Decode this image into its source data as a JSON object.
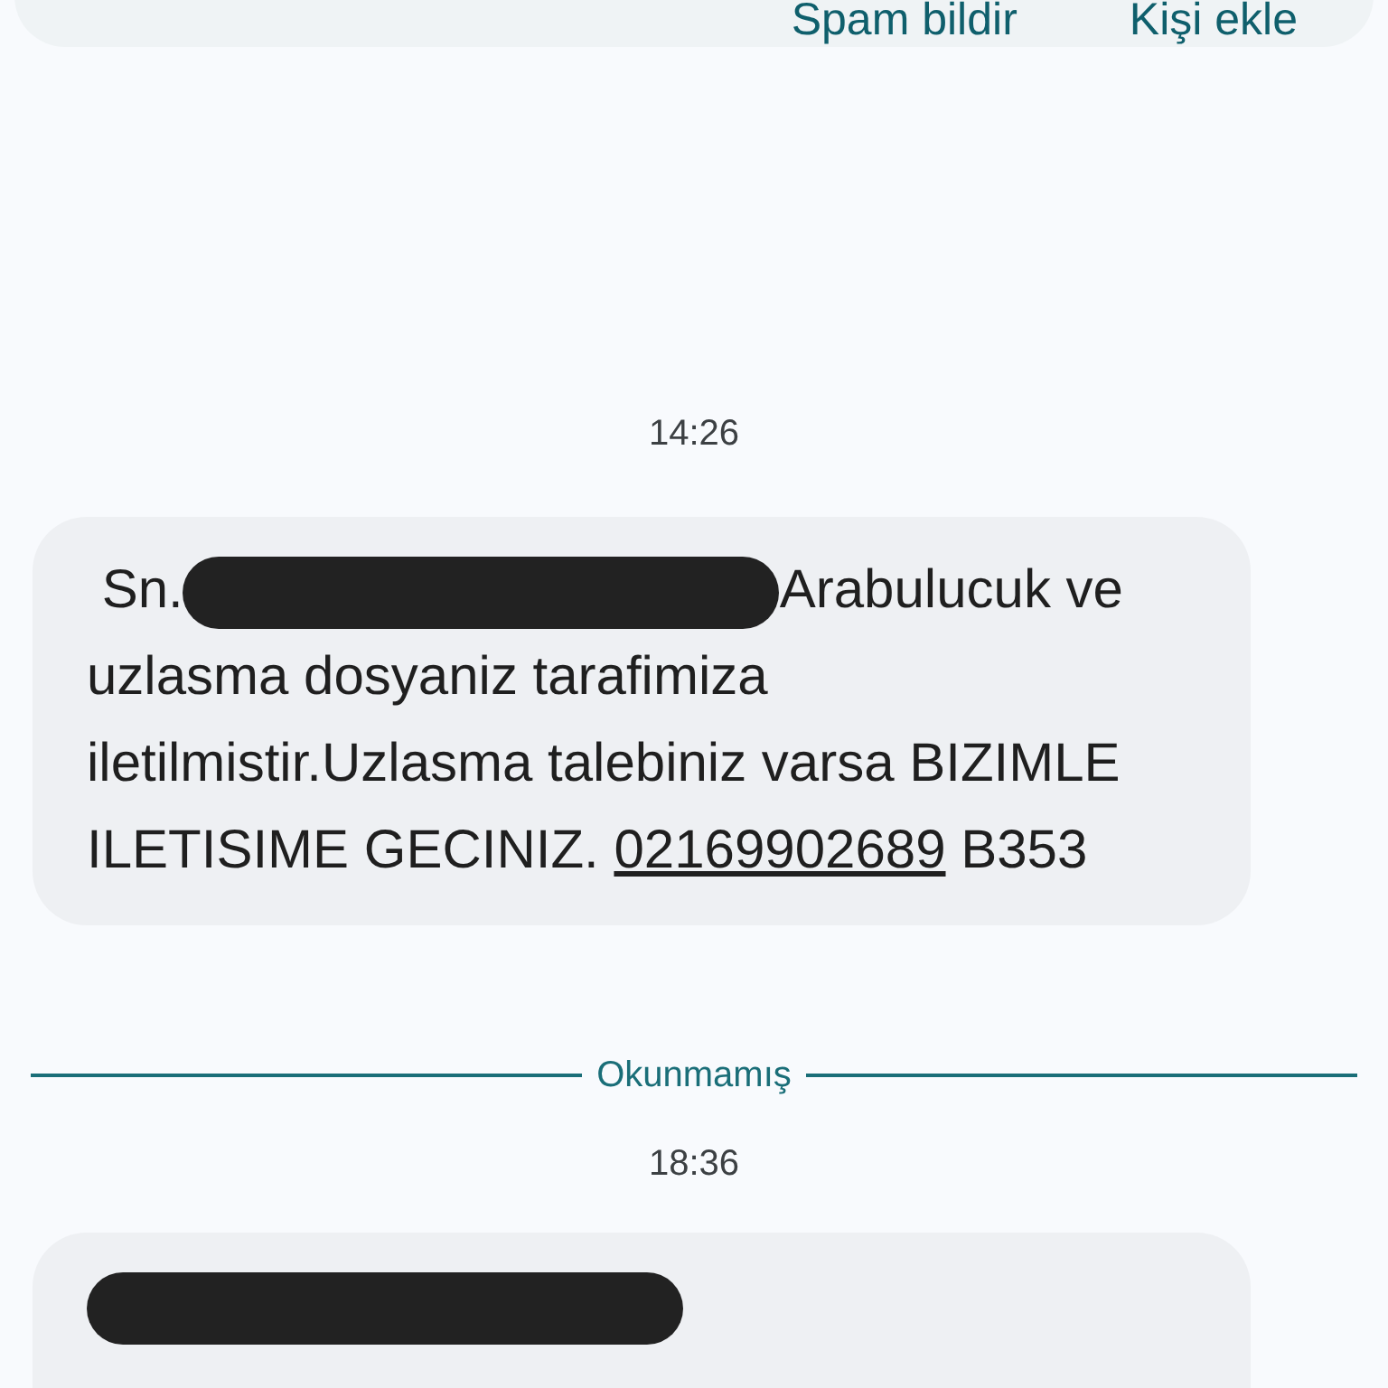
{
  "top_card": {
    "actions": [
      {
        "label": "Spam bildir"
      },
      {
        "label": "Kişi ekle"
      }
    ]
  },
  "conversation": [
    {
      "kind": "timestamp",
      "text": "14:26"
    },
    {
      "kind": "message",
      "parts": [
        {
          "kind": "text",
          "text": " Sn."
        },
        {
          "kind": "redaction"
        },
        {
          "kind": "text",
          "text": "Arabulucuk ve uzlasma dosyaniz tarafimiza iletilmistir.Uzlasma talebiniz varsa BIZIMLE ILETISIME GECINIZ. "
        },
        {
          "kind": "link",
          "text": "02169902689"
        },
        {
          "kind": "text",
          "text": " B353"
        }
      ]
    },
    {
      "kind": "divider",
      "text": "Okunmamış"
    },
    {
      "kind": "timestamp",
      "text": "18:36"
    },
    {
      "kind": "message",
      "parts": [
        {
          "kind": "redaction"
        }
      ]
    }
  ]
}
